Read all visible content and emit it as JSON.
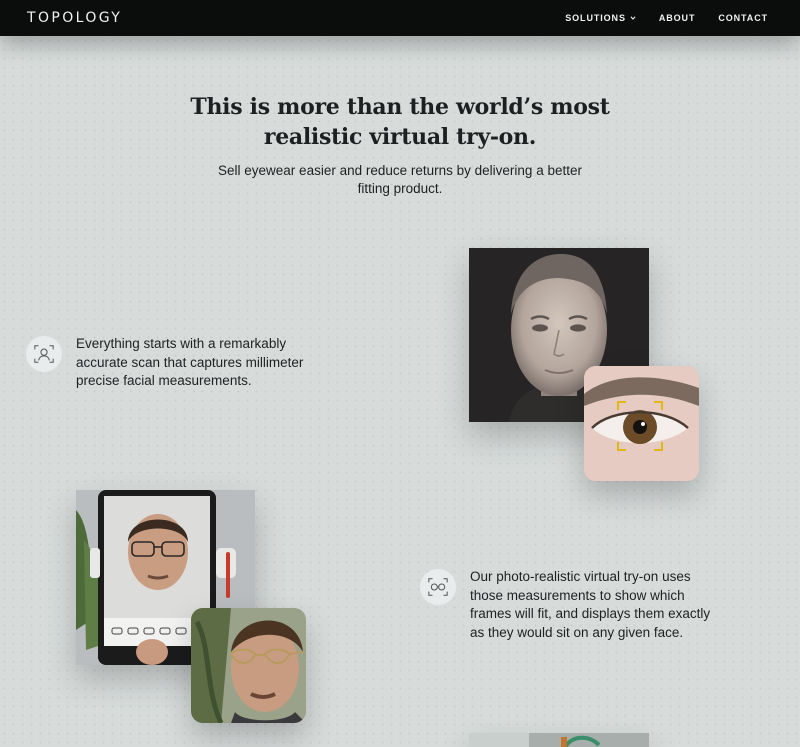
{
  "header": {
    "logo": "TOPOLOGY",
    "nav": [
      {
        "label": "SOLUTIONS",
        "has_dropdown": true
      },
      {
        "label": "ABOUT"
      },
      {
        "label": "CONTACT"
      }
    ]
  },
  "hero": {
    "title_line1": "This is more than the world’s most",
    "title_line2": "realistic virtual try-on.",
    "subtitle_line1": "Sell eyewear easier and reduce returns by delivering a better",
    "subtitle_line2": "fitting product."
  },
  "features": [
    {
      "icon": "face-scan-icon",
      "lines": [
        "Everything starts with a remarkably",
        "accurate scan that captures millimeter",
        "precise facial measurements."
      ]
    },
    {
      "icon": "glasses-tryon-icon",
      "lines": [
        "Our photo-realistic virtual try-on uses",
        "those measurements to show which",
        "frames will fit, and displays them exactly",
        "as they would sit on any given face."
      ]
    }
  ],
  "colors": {
    "nav_bg": "#0b0c0c",
    "page_bg": "#d7dcdb",
    "text": "#1c1d1e",
    "scan_reticle": "#e2b400"
  }
}
